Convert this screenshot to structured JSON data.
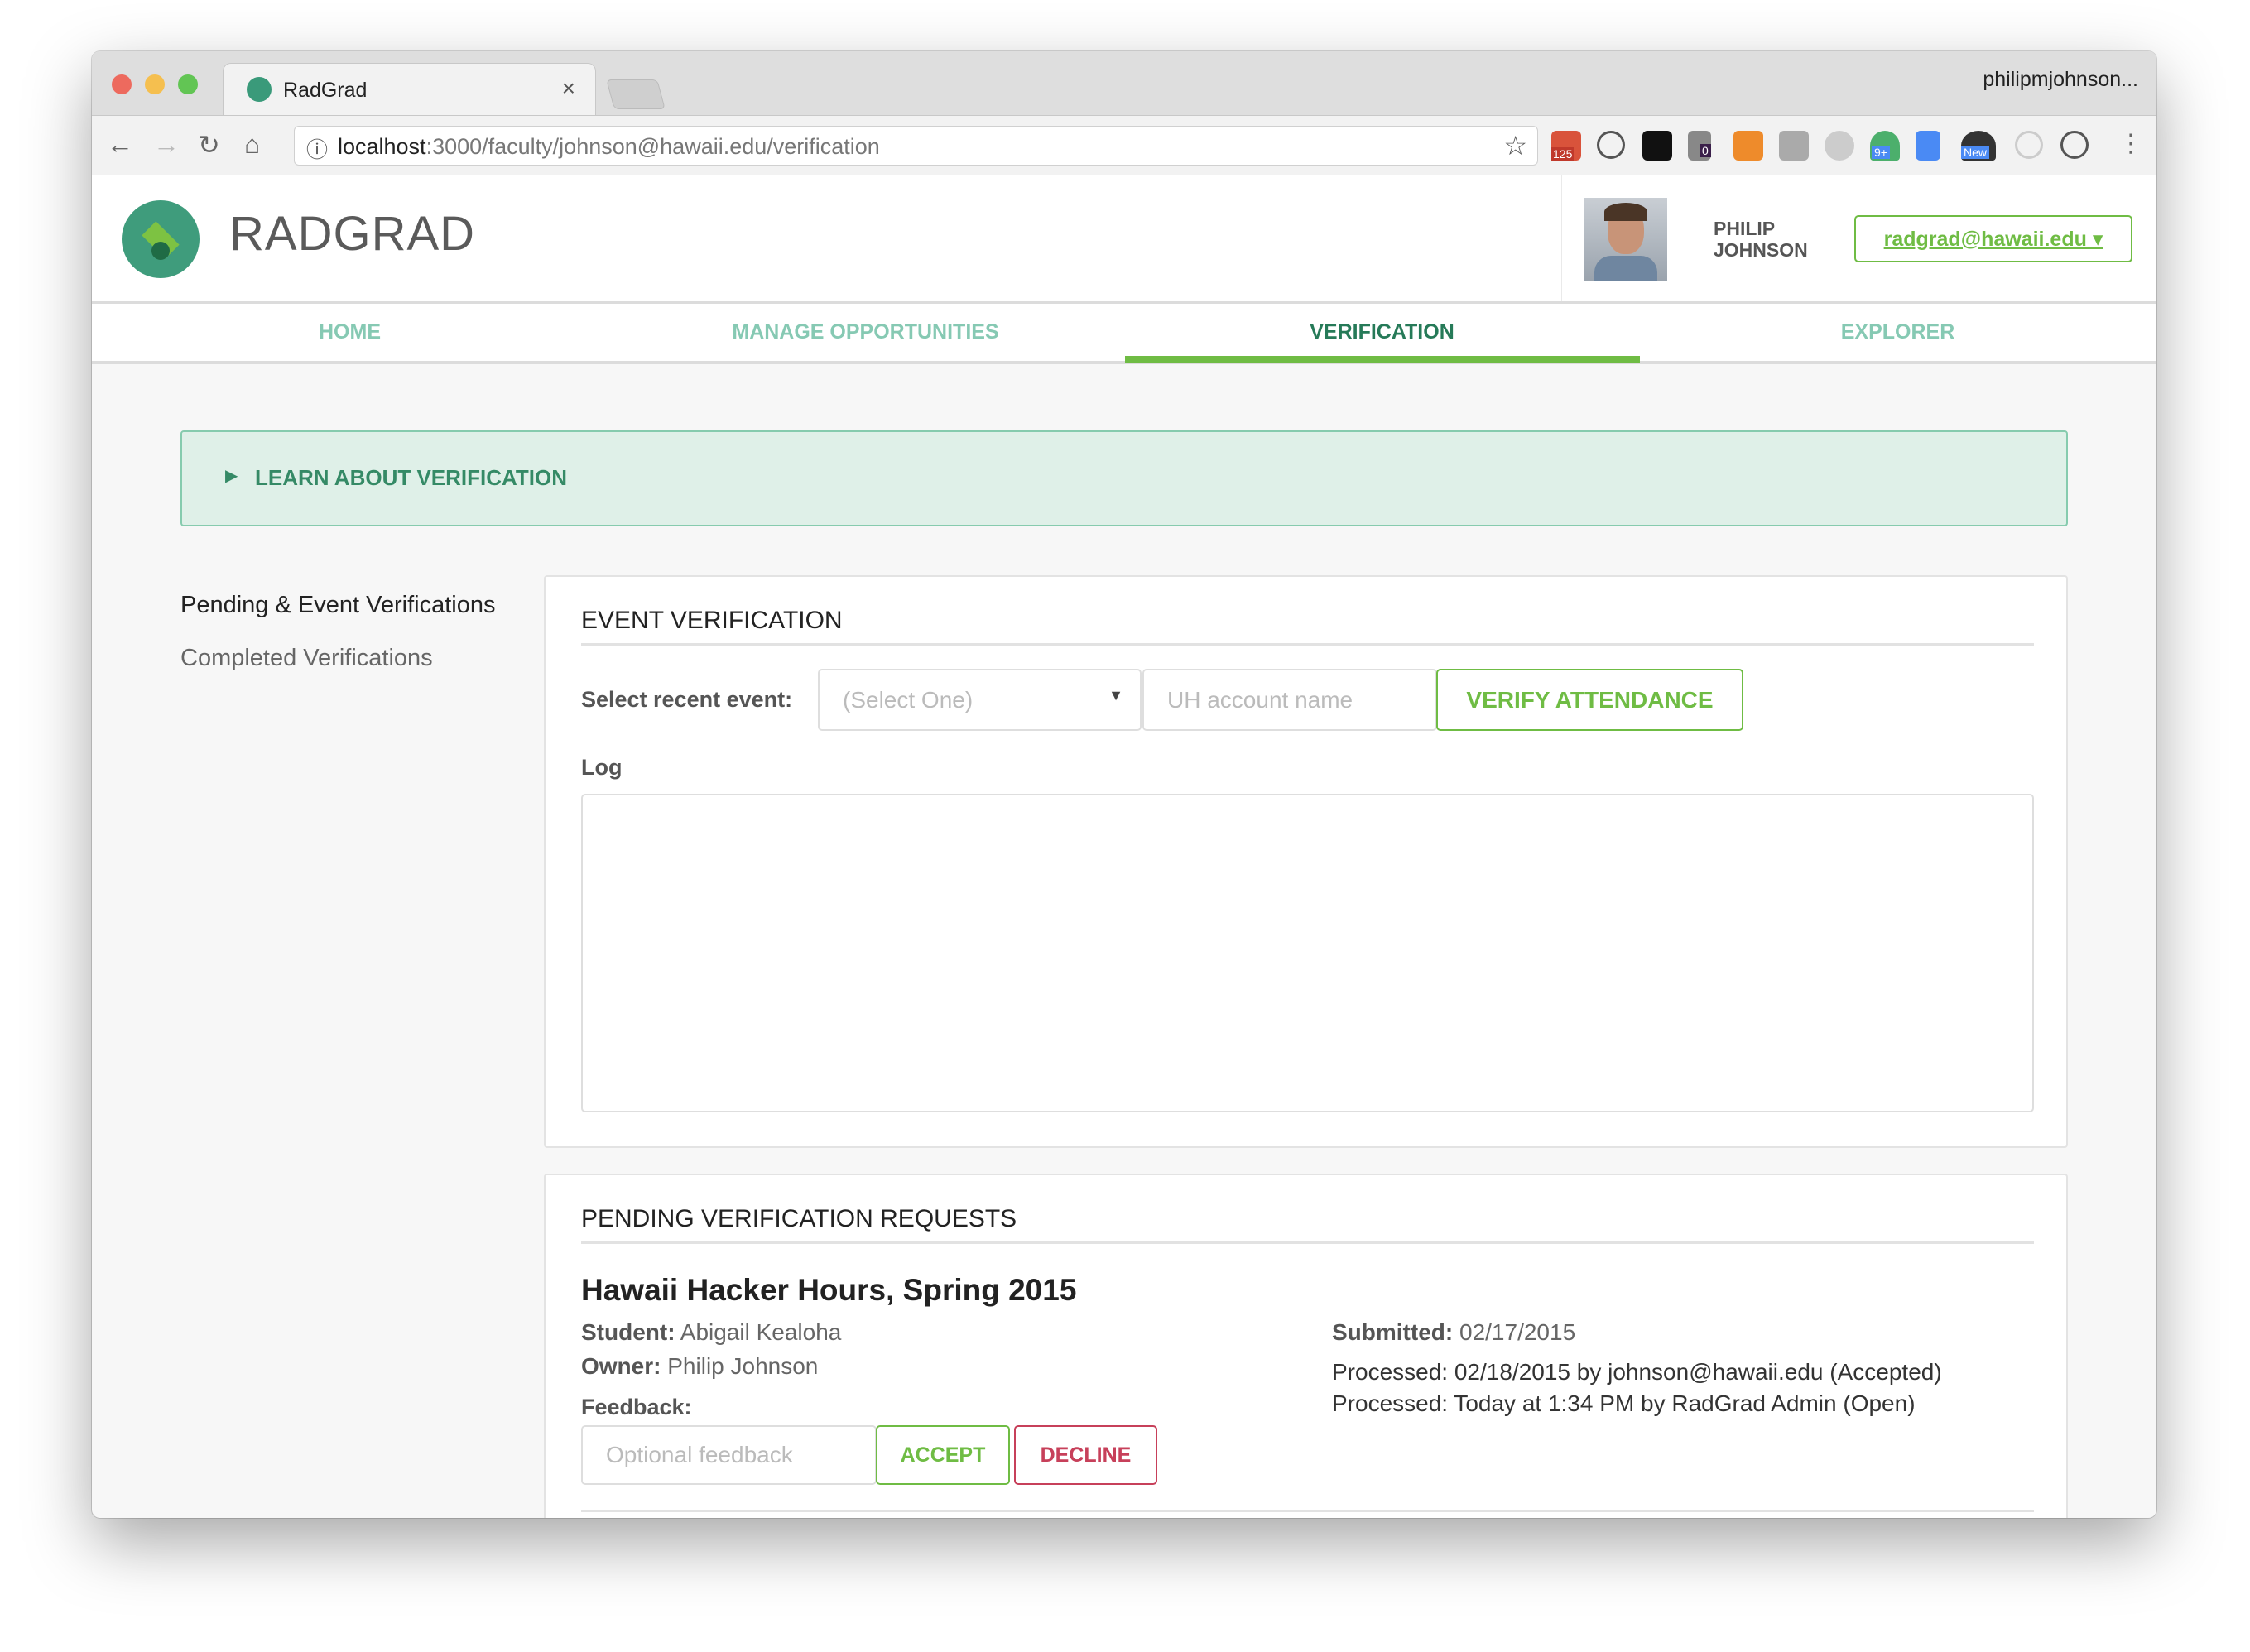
{
  "browser": {
    "tab_title": "RadGrad",
    "profile_name": "philipmjohnson...",
    "url_host": "localhost",
    "url_rest": ":3000/faculty/johnson@hawaii.edu/verification",
    "extension_badges": [
      "125",
      "0",
      "9+",
      "New"
    ]
  },
  "header": {
    "brand": "RADGRAD",
    "user_first": "PHILIP",
    "user_last": "JOHNSON",
    "account_button": "radgrad@hawaii.edu ▾"
  },
  "nav": {
    "items": [
      {
        "label": "HOME",
        "active": false
      },
      {
        "label": "MANAGE OPPORTUNITIES",
        "active": false
      },
      {
        "label": "VERIFICATION",
        "active": true
      },
      {
        "label": "EXPLORER",
        "active": false
      }
    ]
  },
  "learn": {
    "label": "LEARN ABOUT VERIFICATION"
  },
  "sidebar": {
    "items": [
      {
        "label": "Pending & Event Verifications",
        "active": true
      },
      {
        "label": "Completed Verifications",
        "active": false
      }
    ]
  },
  "event_verification": {
    "heading": "EVENT VERIFICATION",
    "select_label": "Select recent event:",
    "select_value": "(Select One)",
    "account_placeholder": "UH account name",
    "verify_button": "VERIFY ATTENDANCE",
    "log_label": "Log",
    "log_value": ""
  },
  "pending": {
    "heading": "PENDING VERIFICATION REQUESTS",
    "requests": [
      {
        "title": "Hawaii Hacker Hours, Spring 2015",
        "student_label": "Student:",
        "student": "Abigail Kealoha",
        "owner_label": "Owner:",
        "owner": "Philip Johnson",
        "feedback_label": "Feedback:",
        "feedback_placeholder": "Optional feedback",
        "accept": "ACCEPT",
        "decline": "DECLINE",
        "submitted_label": "Submitted:",
        "submitted": "02/17/2015",
        "processed": [
          "Processed: 02/18/2015 by johnson@hawaii.edu (Accepted)",
          "Processed: Today at 1:34 PM by RadGrad Admin (Open)"
        ]
      }
    ]
  },
  "colors": {
    "accent_green": "#6fbc44",
    "teal": "#3f9c7c",
    "decline_red": "#c7405a",
    "learn_bg": "#dff0e8"
  }
}
